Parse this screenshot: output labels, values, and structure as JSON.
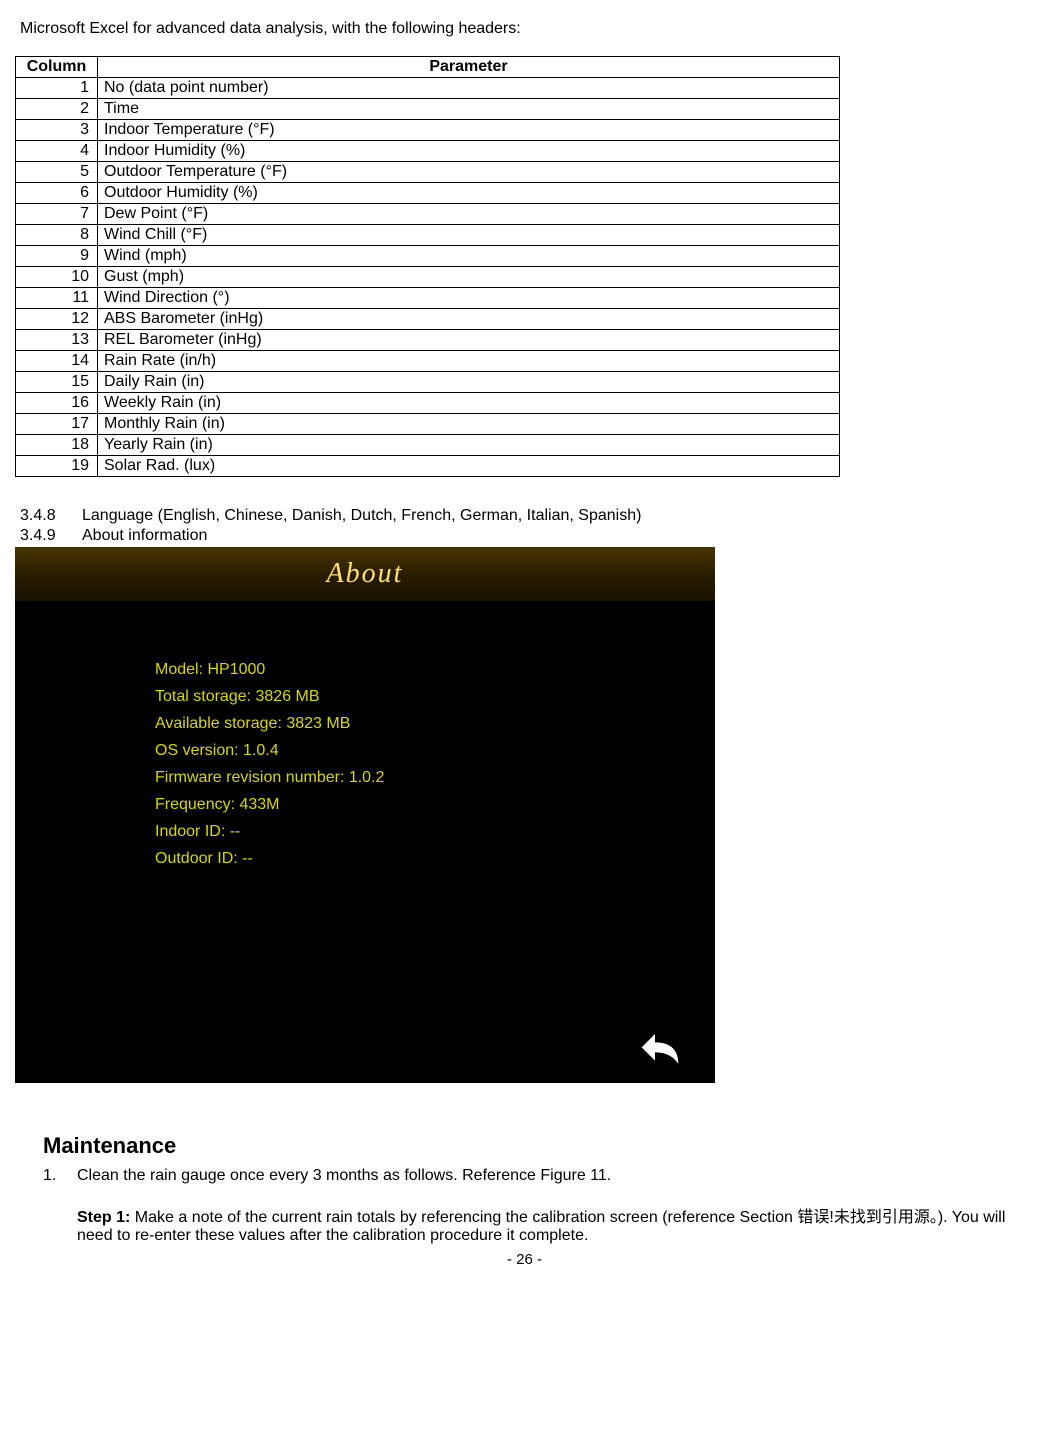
{
  "intro": "Microsoft Excel for advanced data analysis, with the following headers:",
  "table": {
    "headers": {
      "col": "Column",
      "param": "Parameter"
    },
    "rows": [
      {
        "n": "1",
        "p": "No (data point number)"
      },
      {
        "n": "2",
        "p": "Time"
      },
      {
        "n": "3",
        "p": "Indoor Temperature (°F)"
      },
      {
        "n": "4",
        "p": "Indoor Humidity (%)"
      },
      {
        "n": "5",
        "p": "Outdoor Temperature (°F)"
      },
      {
        "n": "6",
        "p": "Outdoor Humidity (%)"
      },
      {
        "n": "7",
        "p": "Dew Point (°F)"
      },
      {
        "n": "8",
        "p": "Wind Chill (°F)"
      },
      {
        "n": "9",
        "p": "Wind (mph)"
      },
      {
        "n": "10",
        "p": "Gust (mph)"
      },
      {
        "n": "11",
        "p": "Wind Direction (°)"
      },
      {
        "n": "12",
        "p": "ABS Barometer (inHg)"
      },
      {
        "n": "13",
        "p": "REL Barometer (inHg)"
      },
      {
        "n": "14",
        "p": "Rain Rate (in/h)"
      },
      {
        "n": "15",
        "p": "Daily Rain (in)"
      },
      {
        "n": "16",
        "p": "Weekly Rain (in)"
      },
      {
        "n": "17",
        "p": "Monthly Rain (in)"
      },
      {
        "n": "18",
        "p": "Yearly Rain (in)"
      },
      {
        "n": "19",
        "p": "Solar Rad. (lux)"
      }
    ]
  },
  "sections": {
    "s348": {
      "num": "3.4.8",
      "text": "Language (English, Chinese, Danish, Dutch, French, German, Italian, Spanish)"
    },
    "s349": {
      "num": "3.4.9",
      "text": "About information"
    }
  },
  "about": {
    "title": "About",
    "lines": [
      "Model: HP1000",
      "Total storage: 3826 MB",
      "Available storage: 3823 MB",
      "OS version: 1.0.4",
      "Firmware revision number: 1.0.2",
      "Frequency: 433M",
      "Indoor ID: --",
      "Outdoor ID: --"
    ]
  },
  "maintenance": {
    "title": "Maintenance",
    "item1_num": "1.",
    "item1_text": "Clean the rain gauge once every 3 months as follows. Reference Figure 11.",
    "step1_label": "Step 1:",
    "step1_text": " Make a note of the current rain totals by referencing the calibration screen (reference Section 错误!未找到引用源。). You will need to re-enter these values after the calibration procedure it complete."
  },
  "pagenum": "- 26 -"
}
